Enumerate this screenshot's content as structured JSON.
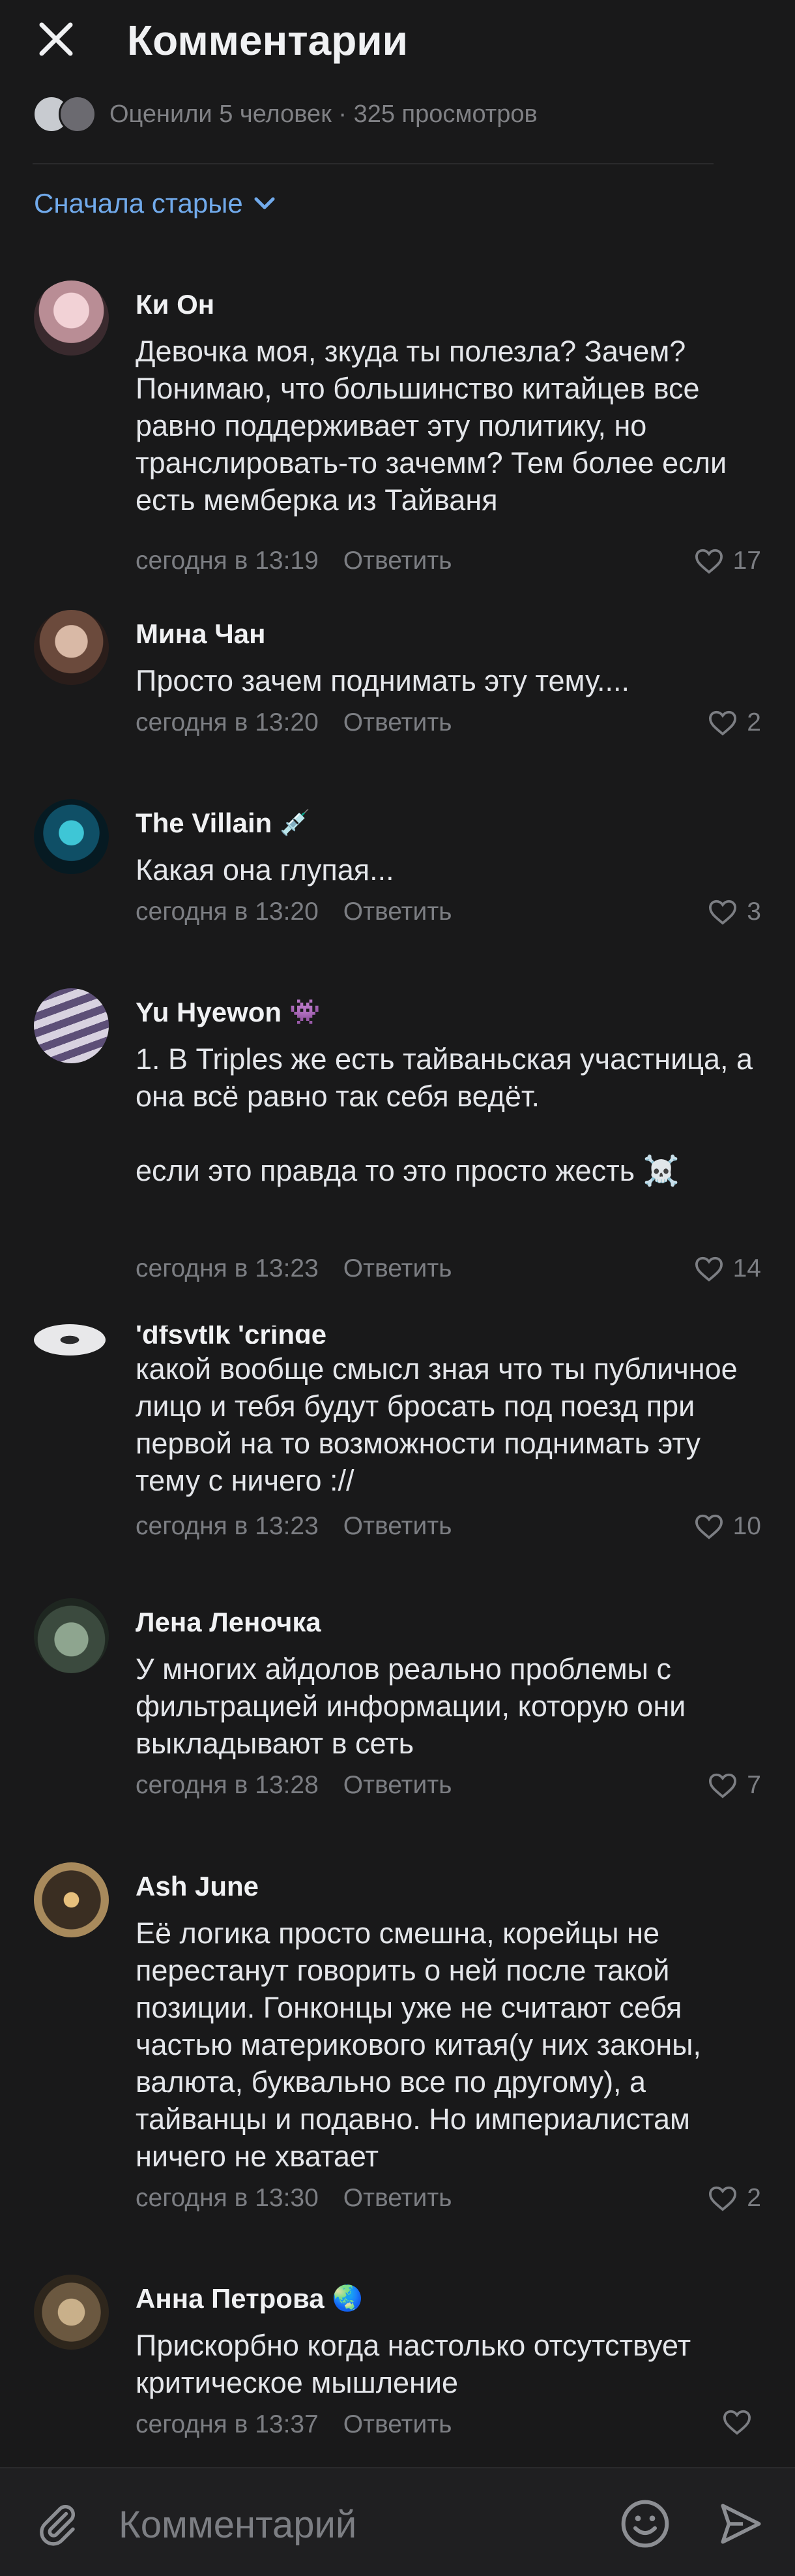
{
  "header": {
    "title": "Комментарии"
  },
  "likes_summary": "Оценили 5 человек · 325 просмотров",
  "sort": {
    "label": "Сначала старые"
  },
  "comments": [
    {
      "name": "Ки Он",
      "text": "Девочка моя, зкуда ты полезла? Зачем? Понимаю, что большинство китайцев все равно поддерживает эту политику, но транслировать-то зачемм? Тем более если есть мемберка из Тайваня",
      "time": "сегодня в 13:19",
      "reply": "Ответить",
      "likes": "17"
    },
    {
      "name": "Мина Чан",
      "text": "Просто зачем поднимать эту тему....",
      "time": "сегодня в 13:20",
      "reply": "Ответить",
      "likes": "2"
    },
    {
      "name": "The Villain",
      "emoji": "💉",
      "text": "Какая она глупая...",
      "time": "сегодня в 13:20",
      "reply": "Ответить",
      "likes": "3"
    },
    {
      "name": "Yu Hyewon",
      "emoji": "👾",
      "text": "1. В Triples же есть тайваньская участница, а она всё равно так себя ведёт.\n\nесли это правда то это просто жесть ☠️",
      "time": "сегодня в 13:23",
      "reply": "Ответить",
      "likes": "14"
    },
    {
      "name": "'dfsytlk 'cringe",
      "text": "какой вообще смысл зная что ты публичное лицо и тебя будут бросать под поезд при первой на то возможности поднимать эту тему с ничего ://",
      "time": "сегодня в 13:23",
      "reply": "Ответить",
      "likes": "10"
    },
    {
      "name": "Лена Леночка",
      "text": "У многих айдолов реально проблемы с фильтрацией информации, которую они выкладывают в сеть",
      "time": "сегодня в 13:28",
      "reply": "Ответить",
      "likes": "7"
    },
    {
      "name": "Ash June",
      "text": "Её логика просто смешна, корейцы не перестанут говорить о ней после такой позиции. Гонконцы уже не считают себя частью материкового китая(у них законы, валюта, буквально все по другому), а тайванцы и подавно. Но империалистам ничего не хватает",
      "time": "сегодня в 13:30",
      "reply": "Ответить",
      "likes": "2"
    },
    {
      "name": "Анна Петрова",
      "emoji": "🌏",
      "text": "Прискорбно когда настолько отсутствует критическое мышление",
      "time": "сегодня в 13:37",
      "reply": "Ответить",
      "likes": ""
    }
  ],
  "footer": {
    "placeholder": "Комментарий"
  },
  "colors": {
    "background": "#19191a",
    "accent": "#71aaeb",
    "secondary_text": "#7c7e83"
  }
}
